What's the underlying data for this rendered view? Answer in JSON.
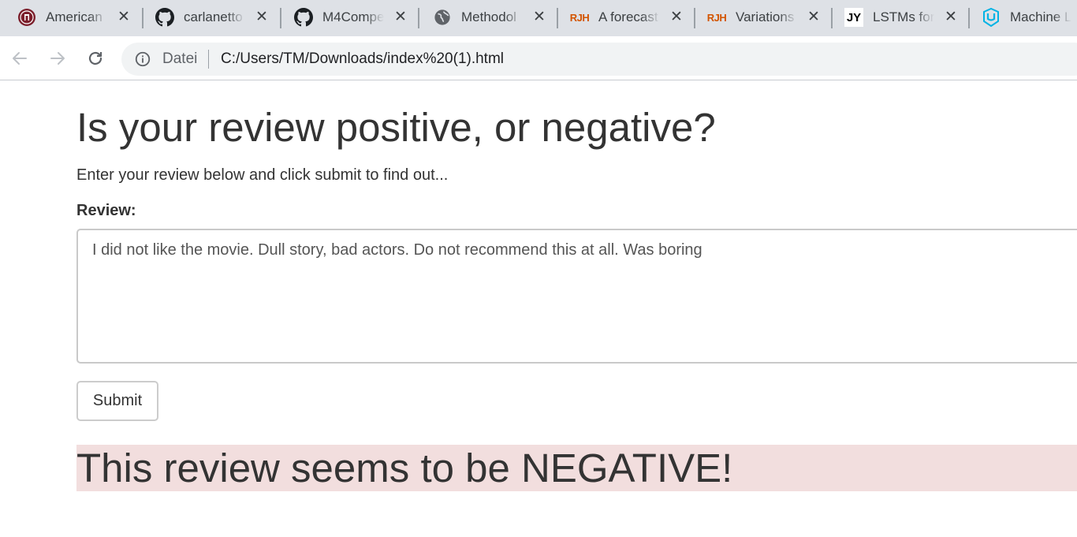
{
  "tabs": [
    {
      "title": "American",
      "icon": "university-seal-icon"
    },
    {
      "title": "carlanetto",
      "icon": "github-icon"
    },
    {
      "title": "M4Compe",
      "icon": "github-icon"
    },
    {
      "title": "Methodol",
      "icon": "globe-icon"
    },
    {
      "title": "A forecast",
      "icon": "rjh-icon",
      "icon_text": "RJH"
    },
    {
      "title": "Variations",
      "icon": "rjh-icon",
      "icon_text": "RJH"
    },
    {
      "title": "LSTMs for",
      "icon": "jy-icon",
      "icon_text": "JY"
    },
    {
      "title": "Machine L",
      "icon": "udacity-icon"
    }
  ],
  "toolbar": {
    "scheme_label": "Datei",
    "url": "C:/Users/TM/Downloads/index%20(1).html"
  },
  "page": {
    "title": "Is your review positive, or negative?",
    "intro": "Enter your review below and click submit to find out...",
    "review_label": "Review:",
    "review_value": "I did not like the movie. Dull story, bad actors. Do not recommend this at all. Was boring",
    "submit_label": "Submit",
    "result_text": "This review seems to be NEGATIVE!"
  },
  "colors": {
    "tabstrip_bg": "#dee1e6",
    "result_bg": "#f2dede",
    "text": "#333333",
    "rjh": "#d35400",
    "udacity": "#02b3e4",
    "seal": "#7b1e2b"
  }
}
